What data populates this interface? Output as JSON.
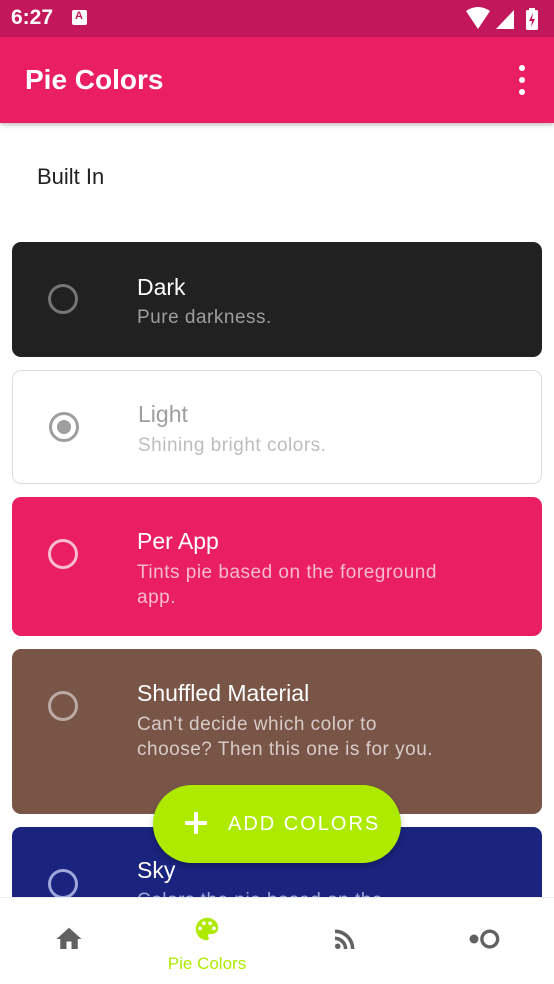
{
  "status_bar": {
    "time": "6:27"
  },
  "app_bar": {
    "title": "Pie Colors"
  },
  "section": {
    "title": "Built In"
  },
  "themes": [
    {
      "name": "Dark",
      "description": "Pure darkness.",
      "selected": false,
      "bg": "#212121",
      "name_color": "#ffffff",
      "desc_color": "#9e9e9e",
      "radio_color": "#757575"
    },
    {
      "name": "Light",
      "description": "Shining bright colors.",
      "selected": true,
      "bg": "#ffffff",
      "name_color": "#9e9e9e",
      "desc_color": "#bdbdbd",
      "radio_color": "#9e9e9e"
    },
    {
      "name": "Per App",
      "description": "Tints pie based on the foreground app.",
      "selected": false,
      "bg": "#e91e63",
      "name_color": "#ffffff",
      "desc_color": "#f8bbd0",
      "radio_color": "#f8bbd0"
    },
    {
      "name": "Shuffled Material",
      "description": "Can't decide which color to choose? Then this one is for you.",
      "selected": false,
      "bg": "#795548",
      "name_color": "#ffffff",
      "desc_color": "#d7ccc8",
      "radio_color": "#bcaaa4"
    },
    {
      "name": "Sky",
      "description": "Colors the pie based on the",
      "selected": false,
      "bg": "#1a237e",
      "name_color": "#ffffff",
      "desc_color": "#9fa8da",
      "radio_color": "#9fa8da"
    }
  ],
  "fab": {
    "label": "ADD COLORS"
  },
  "bottom_nav": {
    "items": [
      {
        "icon": "home-icon",
        "label": ""
      },
      {
        "icon": "palette-icon",
        "label": "Pie Colors"
      },
      {
        "icon": "rss-feed-icon",
        "label": ""
      },
      {
        "icon": "toggle-dots-icon",
        "label": ""
      }
    ],
    "active_index": 1
  },
  "colors": {
    "status_bar": "#c2185b",
    "primary": "#e91e63",
    "accent": "#aeea00",
    "nav_icon": "#616161"
  }
}
